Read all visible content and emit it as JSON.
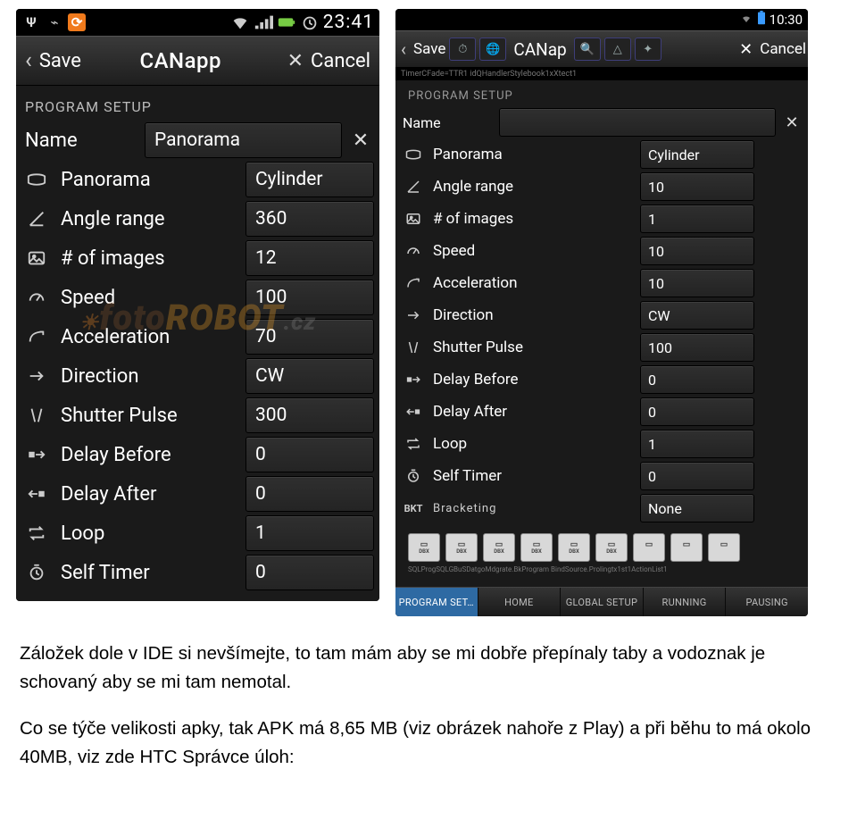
{
  "left": {
    "status": {
      "time": "23:41"
    },
    "header": {
      "save": "Save",
      "title": "CANapp",
      "cancel": "Cancel"
    },
    "section": "PROGRAM SETUP",
    "name_field": {
      "label": "Name",
      "value": "Panorama"
    },
    "rows": [
      {
        "icon": "panorama-icon",
        "label": "Panorama",
        "value": "Cylinder"
      },
      {
        "icon": "angle-icon",
        "label": "Angle range",
        "value": "360"
      },
      {
        "icon": "images-icon",
        "label": "# of images",
        "value": "12"
      },
      {
        "icon": "speed-icon",
        "label": "Speed",
        "value": "100"
      },
      {
        "icon": "accel-icon",
        "label": "Acceleration",
        "value": "70"
      },
      {
        "icon": "direction-icon",
        "label": "Direction",
        "value": "CW"
      },
      {
        "icon": "shutter-icon",
        "label": "Shutter Pulse",
        "value": "300"
      },
      {
        "icon": "dbefore-icon",
        "label": "Delay Before",
        "value": "0"
      },
      {
        "icon": "dafter-icon",
        "label": "Delay After",
        "value": "0"
      },
      {
        "icon": "loop-icon",
        "label": "Loop",
        "value": "1"
      },
      {
        "icon": "timer-icon",
        "label": "Self Timer",
        "value": "0"
      }
    ],
    "watermark": "fotoROBOT.cz"
  },
  "right": {
    "status": {
      "time": "10:30"
    },
    "header": {
      "save": "Save",
      "title": "CANap",
      "cancel": "Cancel"
    },
    "debug_top": "TimerCFade=TTR1     idQHandlerStylebook1xXtect1",
    "section": "PROGRAM SETUP",
    "name_field": {
      "label": "Name",
      "value": ""
    },
    "rows": [
      {
        "icon": "panorama-icon",
        "label": "Panorama",
        "value": "Cylinder"
      },
      {
        "icon": "angle-icon",
        "label": "Angle range",
        "value": "10"
      },
      {
        "icon": "images-icon",
        "label": "# of images",
        "value": "1"
      },
      {
        "icon": "speed-icon",
        "label": "Speed",
        "value": "10"
      },
      {
        "icon": "accel-icon",
        "label": "Acceleration",
        "value": "10"
      },
      {
        "icon": "direction-icon",
        "label": "Direction",
        "value": "CW"
      },
      {
        "icon": "shutter-icon",
        "label": "Shutter Pulse",
        "value": "100"
      },
      {
        "icon": "dbefore-icon",
        "label": "Delay Before",
        "value": "0"
      },
      {
        "icon": "dafter-icon",
        "label": "Delay After",
        "value": "0"
      },
      {
        "icon": "loop-icon",
        "label": "Loop",
        "value": "1"
      },
      {
        "icon": "timer-icon",
        "label": "Self Timer",
        "value": "0"
      },
      {
        "icon": "bkt-icon",
        "label": "Bracketing",
        "value": "None"
      }
    ],
    "dbx_row": [
      "DBX",
      "DBX",
      "DBX",
      "DBX",
      "DBX",
      "DBX",
      "",
      "",
      ""
    ],
    "debug_bottom": "SQLProgSQLGBuSDatgoMdgrate.BkProgram   BindSource.Prolingtx1st1ActionList1",
    "tabs": [
      {
        "label": "PROGRAM SET…",
        "active": true
      },
      {
        "label": "HOME",
        "active": false
      },
      {
        "label": "GLOBAL SETUP",
        "active": false
      },
      {
        "label": "RUNNING",
        "active": false
      },
      {
        "label": "PAUSING",
        "active": false
      }
    ]
  },
  "doc": {
    "p1": "Záložek dole v IDE si nevšímejte, to tam mám aby se mi dobře přepínaly taby a vodoznak je schovaný aby se mi tam nemotal.",
    "p2": "Co se týče velikosti apky, tak APK má 8,65 MB (viz obrázek nahoře z Play) a při běhu to má okolo 40MB, viz zde HTC Správce úloh:"
  }
}
